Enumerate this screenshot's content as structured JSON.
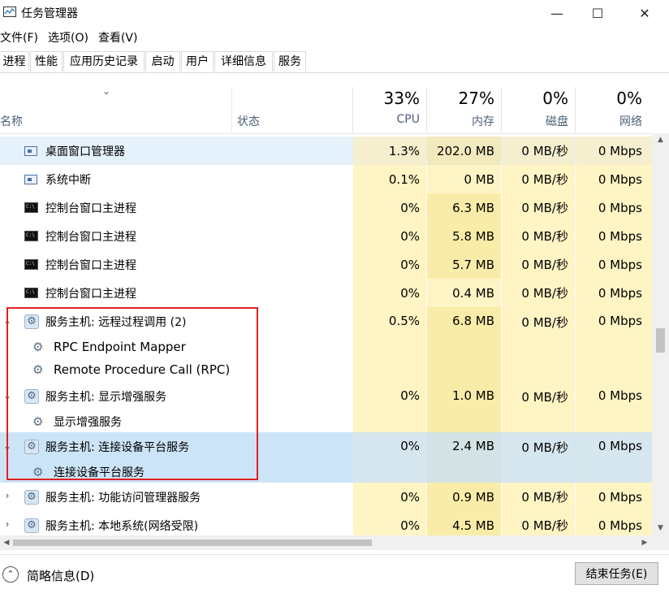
{
  "window": {
    "title": "任务管理器",
    "minimize": "—",
    "maximize": "☐",
    "close": "✕"
  },
  "menu": [
    "文件(F)",
    "选项(O)",
    "查看(V)"
  ],
  "tabs": [
    "进程",
    "性能",
    "应用历史记录",
    "启动",
    "用户",
    "详细信息",
    "服务"
  ],
  "columns": {
    "name": "名称",
    "status": "状态",
    "cpu": {
      "pct": "33%",
      "label": "CPU"
    },
    "mem": {
      "pct": "27%",
      "label": "内存"
    },
    "disk": {
      "pct": "0%",
      "label": "磁盘"
    },
    "net": {
      "pct": "0%",
      "label": "网络"
    }
  },
  "rows": [
    {
      "name": "桌面窗口管理器",
      "icon": "window-icon",
      "cpu": "1.3%",
      "mem": "202.0 MB",
      "disk": "0 MB/秒",
      "net": "0 Mbps"
    },
    {
      "name": "系统中断",
      "icon": "window-icon",
      "cpu": "0.1%",
      "mem": "0 MB",
      "disk": "0 MB/秒",
      "net": "0 Mbps"
    },
    {
      "name": "控制台窗口主进程",
      "icon": "console-icon",
      "cpu": "0%",
      "mem": "6.3 MB",
      "disk": "0 MB/秒",
      "net": "0 Mbps"
    },
    {
      "name": "控制台窗口主进程",
      "icon": "console-icon",
      "cpu": "0%",
      "mem": "5.8 MB",
      "disk": "0 MB/秒",
      "net": "0 Mbps"
    },
    {
      "name": "控制台窗口主进程",
      "icon": "console-icon",
      "cpu": "0%",
      "mem": "5.7 MB",
      "disk": "0 MB/秒",
      "net": "0 Mbps"
    },
    {
      "name": "控制台窗口主进程",
      "icon": "console-icon",
      "cpu": "0%",
      "mem": "0.4 MB",
      "disk": "0 MB/秒",
      "net": "0 Mbps"
    },
    {
      "name": "服务主机: 远程过程调用 (2)",
      "icon": "service-host-icon",
      "cpu": "0.5%",
      "mem": "6.8 MB",
      "disk": "0 MB/秒",
      "net": "0 Mbps",
      "children": [
        "RPC Endpoint Mapper",
        "Remote Procedure Call (RPC)"
      ]
    },
    {
      "name": "服务主机: 显示增强服务",
      "icon": "service-host-icon",
      "cpu": "0%",
      "mem": "1.0 MB",
      "disk": "0 MB/秒",
      "net": "0 Mbps",
      "children": [
        "显示增强服务"
      ]
    },
    {
      "name": "服务主机: 连接设备平台服务",
      "icon": "service-host-icon",
      "cpu": "0%",
      "mem": "2.4 MB",
      "disk": "0 MB/秒",
      "net": "0 Mbps",
      "children": [
        "连接设备平台服务"
      ]
    },
    {
      "name": "服务主机: 功能访问管理器服务",
      "icon": "service-host-icon",
      "cpu": "0%",
      "mem": "0.9 MB",
      "disk": "0 MB/秒",
      "net": "0 Mbps"
    },
    {
      "name": "服务主机: 本地系统(网络受限)",
      "icon": "service-host-icon",
      "cpu": "0%",
      "mem": "4.5 MB",
      "disk": "0 MB/秒",
      "net": "0 Mbps"
    }
  ],
  "footer": {
    "fewer_details": "简略信息(D)",
    "end_task": "结束任务(E)"
  },
  "colors": {
    "heat_light": "#fff4c4",
    "heat_mid": "#f9eca8",
    "selected": "#cce4f7",
    "hover": "#e5f1fb",
    "highlight_box": "#e02020"
  }
}
